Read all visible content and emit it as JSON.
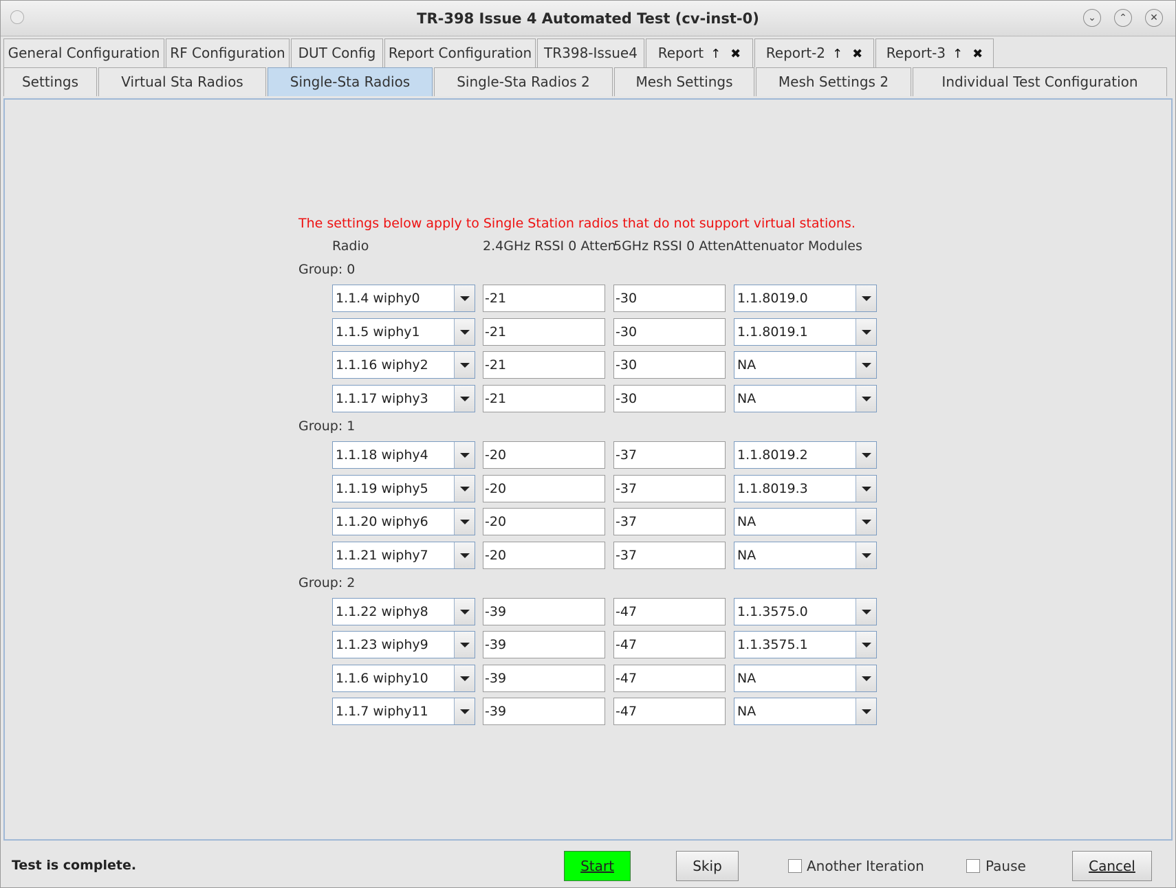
{
  "window": {
    "title": "TR-398 Issue 4 Automated Test  (cv-inst-0)"
  },
  "tabs_row1": [
    {
      "label": "General Configuration"
    },
    {
      "label": "RF Configuration"
    },
    {
      "label": "DUT Config"
    },
    {
      "label": "Report Configuration"
    },
    {
      "label": "TR398-Issue4"
    },
    {
      "label": "Report",
      "pin": "↑",
      "close": "✖"
    },
    {
      "label": "Report-2",
      "pin": "↑",
      "close": "✖"
    },
    {
      "label": "Report-3",
      "pin": "↑",
      "close": "✖"
    }
  ],
  "tabs_row2": [
    {
      "label": "Settings"
    },
    {
      "label": "Virtual Sta Radios"
    },
    {
      "label": "Single-Sta Radios",
      "active": true
    },
    {
      "label": "Single-Sta Radios 2"
    },
    {
      "label": "Mesh Settings"
    },
    {
      "label": "Mesh Settings 2"
    },
    {
      "label": "Individual Test Configuration"
    }
  ],
  "notice": "The settings below apply to Single Station radios that do not support virtual stations.",
  "columns": {
    "radio": "Radio",
    "rssi24": "2.4GHz RSSI 0 Atten",
    "rssi5": "5GHz RSSI 0 Atten",
    "atten": "Attenuator Modules"
  },
  "groups": [
    {
      "label": "Group: 0",
      "rows": [
        {
          "radio": "1.1.4 wiphy0",
          "rssi24": "-21",
          "rssi5": "-30",
          "atten": "1.1.8019.0"
        },
        {
          "radio": "1.1.5 wiphy1",
          "rssi24": "-21",
          "rssi5": "-30",
          "atten": "1.1.8019.1"
        },
        {
          "radio": "1.1.16 wiphy2",
          "rssi24": "-21",
          "rssi5": "-30",
          "atten": "NA"
        },
        {
          "radio": "1.1.17 wiphy3",
          "rssi24": "-21",
          "rssi5": "-30",
          "atten": "NA"
        }
      ]
    },
    {
      "label": "Group: 1",
      "rows": [
        {
          "radio": "1.1.18 wiphy4",
          "rssi24": "-20",
          "rssi5": "-37",
          "atten": "1.1.8019.2"
        },
        {
          "radio": "1.1.19 wiphy5",
          "rssi24": "-20",
          "rssi5": "-37",
          "atten": "1.1.8019.3"
        },
        {
          "radio": "1.1.20 wiphy6",
          "rssi24": "-20",
          "rssi5": "-37",
          "atten": "NA"
        },
        {
          "radio": "1.1.21 wiphy7",
          "rssi24": "-20",
          "rssi5": "-37",
          "atten": "NA"
        }
      ]
    },
    {
      "label": "Group: 2",
      "rows": [
        {
          "radio": "1.1.22 wiphy8",
          "rssi24": "-39",
          "rssi5": "-47",
          "atten": "1.1.3575.0"
        },
        {
          "radio": "1.1.23 wiphy9",
          "rssi24": "-39",
          "rssi5": "-47",
          "atten": "1.1.3575.1"
        },
        {
          "radio": "1.1.6 wiphy10",
          "rssi24": "-39",
          "rssi5": "-47",
          "atten": "NA"
        },
        {
          "radio": "1.1.7 wiphy11",
          "rssi24": "-39",
          "rssi5": "-47",
          "atten": "NA"
        }
      ]
    }
  ],
  "footer": {
    "status": "Test is complete.",
    "start_label": "Start",
    "skip_label": "Skip",
    "another_iteration_label": "Another Iteration",
    "another_iteration_checked": false,
    "pause_label": "Pause",
    "pause_checked": false,
    "cancel_label": "Cancel"
  },
  "colors": {
    "start_button": "#00ff00",
    "notice_text": "#ee1111",
    "active_tab": "#c5dbf0"
  }
}
